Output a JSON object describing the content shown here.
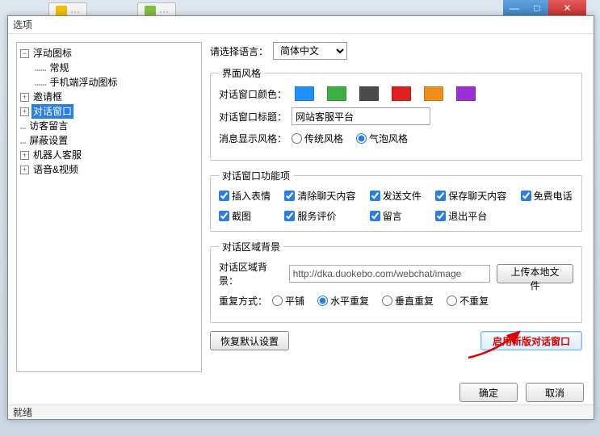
{
  "outer": {
    "tab1": "···",
    "tab2": "···"
  },
  "dialog": {
    "title": "选项",
    "status": "就绪",
    "ok": "确定",
    "cancel": "取消"
  },
  "tree": {
    "items": [
      {
        "indent": 0,
        "expander": "−",
        "label": "浮动图标",
        "selected": false
      },
      {
        "indent": 1,
        "expander": "",
        "label": "常规",
        "selected": false,
        "dots": "……"
      },
      {
        "indent": 1,
        "expander": "",
        "label": "手机端浮动图标",
        "selected": false,
        "dots": "……"
      },
      {
        "indent": 0,
        "expander": "+",
        "label": "邀请框",
        "selected": false
      },
      {
        "indent": 0,
        "expander": "+",
        "label": "对话窗口",
        "selected": true
      },
      {
        "indent": 0,
        "expander": "",
        "label": "访客留言",
        "selected": false,
        "dots": "…"
      },
      {
        "indent": 0,
        "expander": "",
        "label": "屏蔽设置",
        "selected": false,
        "dots": "…"
      },
      {
        "indent": 0,
        "expander": "+",
        "label": "机器人客服",
        "selected": false
      },
      {
        "indent": 0,
        "expander": "+",
        "label": "语音&视频",
        "selected": false
      }
    ]
  },
  "lang": {
    "label": "请选择语言：",
    "value": "简体中文"
  },
  "panel_style": {
    "legend": "界面风格",
    "color_label": "对话窗口颜色：",
    "colors": [
      "#1e90ff",
      "#3cb043",
      "#4a4a4a",
      "#e02020",
      "#f08c1a",
      "#9b2fd6"
    ],
    "title_label": "对话窗口标题：",
    "title_value": "网站客服平台",
    "msg_style_label": "消息显示风格：",
    "msg_style_options": {
      "classic": "传统风格",
      "bubble": "气泡风格"
    },
    "msg_style_selected": "bubble"
  },
  "panel_func": {
    "legend": "对话窗口功能项",
    "items": [
      {
        "label": "插入表情",
        "checked": true
      },
      {
        "label": "清除聊天内容",
        "checked": true
      },
      {
        "label": "发送文件",
        "checked": true
      },
      {
        "label": "保存聊天内容",
        "checked": true
      },
      {
        "label": "免费电话",
        "checked": true
      },
      {
        "label": "截图",
        "checked": true
      },
      {
        "label": "服务评价",
        "checked": true
      },
      {
        "label": "留言",
        "checked": true
      },
      {
        "label": "退出平台",
        "checked": true
      }
    ]
  },
  "panel_bg": {
    "legend": "对话区域背景",
    "bg_label": "对话区域背景：",
    "bg_url": "http://dka.duokebo.com/webchat/image",
    "upload": "上传本地文件",
    "repeat_label": "重复方式：",
    "repeat_options": {
      "tile": "平铺",
      "hrepeat": "水平重复",
      "vrepeat": "垂直重复",
      "norepeat": "不重复"
    },
    "repeat_selected": "hrepeat"
  },
  "actions": {
    "reset": "恢复默认设置",
    "new_dialog": "启用新版对话窗口"
  }
}
